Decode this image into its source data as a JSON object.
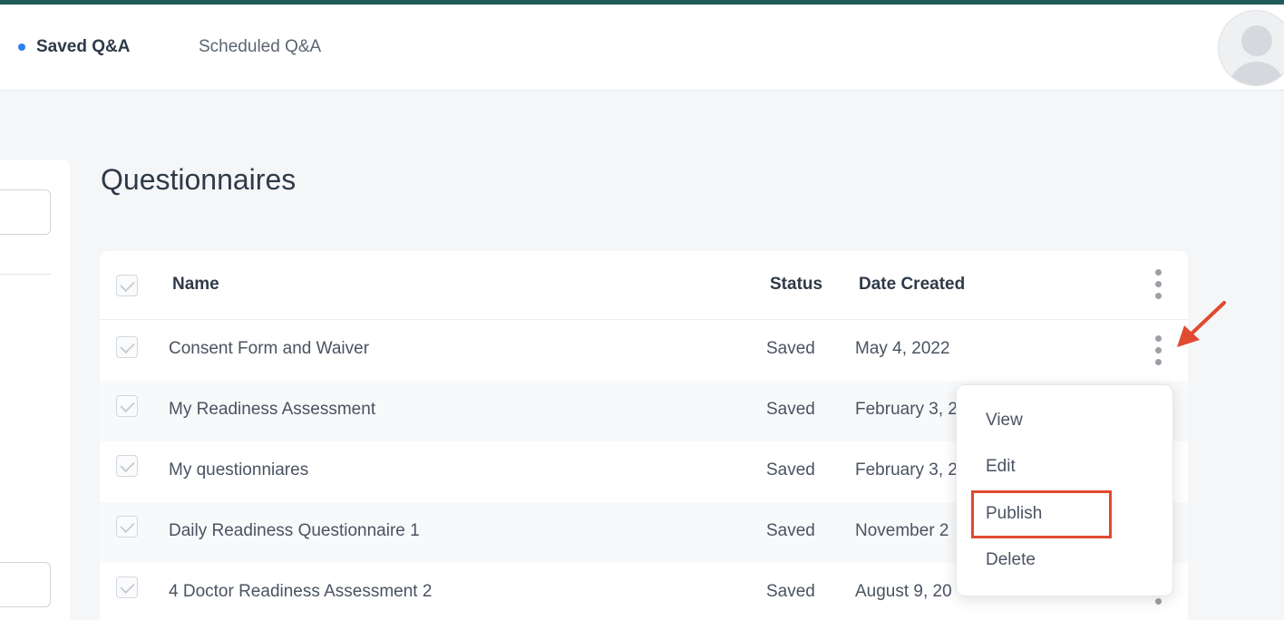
{
  "header": {
    "tabs": [
      {
        "label": "Saved Q&A",
        "active": true
      },
      {
        "label": "Scheduled Q&A",
        "active": false
      }
    ],
    "accent_color": "#1f5b5b",
    "active_dot_color": "#2f80ed"
  },
  "page": {
    "title": "Questionnaires"
  },
  "table": {
    "columns": [
      "Name",
      "Status",
      "Date Created"
    ],
    "rows": [
      {
        "name": "Consent Form and Waiver",
        "status": "Saved",
        "date": "May 4, 2022"
      },
      {
        "name": "My Readiness Assessment",
        "status": "Saved",
        "date": "February 3, 2"
      },
      {
        "name": "My questionniares",
        "status": "Saved",
        "date": "February 3, 2"
      },
      {
        "name": "Daily Readiness Questionnaire 1",
        "status": "Saved",
        "date": "November 2"
      },
      {
        "name": "4 Doctor Readiness Assessment 2",
        "status": "Saved",
        "date": "August 9, 20"
      }
    ]
  },
  "row_menu": {
    "items": [
      "View",
      "Edit",
      "Publish",
      "Delete"
    ],
    "highlighted": "Publish",
    "highlight_color": "#e04a2f"
  },
  "icons": {
    "row_actions": "kebab-vertical-icon",
    "annotation": "red-arrow-icon",
    "avatar": "user-avatar-icon"
  }
}
